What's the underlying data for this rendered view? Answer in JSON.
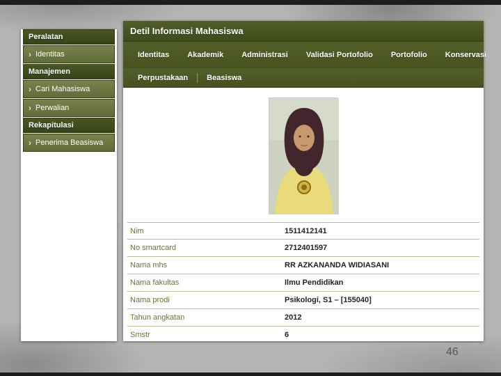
{
  "slide": {
    "page_number": "46"
  },
  "sidebar": {
    "sections": [
      {
        "header": "Peralatan",
        "items": [
          "Identitas"
        ]
      },
      {
        "header": "Manajemen",
        "items": [
          "Cari Mahasiswa",
          "Perwalian"
        ]
      },
      {
        "header": "Rekapitulasi",
        "items": [
          "Penerima Beasiswa"
        ]
      }
    ]
  },
  "main": {
    "title": "Detil Informasi Mahasiswa",
    "tabs_row1": [
      "Identitas",
      "Akademik",
      "Administrasi",
      "Validasi Portofolio",
      "Portofolio",
      "Konservasi"
    ],
    "tabs_row2": [
      "Perpustakaan",
      "Beasiswa"
    ],
    "details": [
      {
        "label": "Nim",
        "value": "1511412141"
      },
      {
        "label": "No smartcard",
        "value": "2712401597"
      },
      {
        "label": "Nama mhs",
        "value": "RR AZKANANDA WIDIASANI"
      },
      {
        "label": "Nama fakultas",
        "value": "Ilmu Pendidikan"
      },
      {
        "label": "Nama prodi",
        "value": "Psikologi, S1 – [155040]"
      },
      {
        "label": "Tahun angkatan",
        "value": "2012"
      },
      {
        "label": "Smstr",
        "value": "6"
      }
    ]
  },
  "colors": {
    "sidebar_header": "#3e491d",
    "sidebar_item": "#6b7540",
    "header_bar": "#48531f",
    "tab_bar": "#4f5a26",
    "label_text": "#6a7338",
    "row_divider": "#b9bd9a",
    "slide_background": "#b4b4b2"
  }
}
